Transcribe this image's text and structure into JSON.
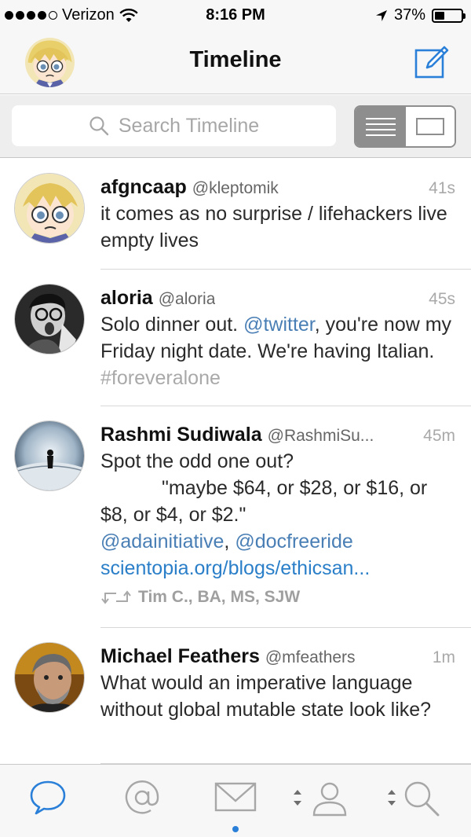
{
  "status_bar": {
    "carrier": "Verizon",
    "time": "8:16 PM",
    "battery_percent": "37%",
    "battery_level": 0.37
  },
  "nav": {
    "title": "Timeline",
    "avatar_icon": "anime-avatar-icon",
    "compose_icon": "compose-icon"
  },
  "search": {
    "placeholder": "Search Timeline",
    "view_mode": "list"
  },
  "colors": {
    "accent": "#2a7fd8",
    "mention": "#4a7fb5",
    "muted": "#a9a9a9"
  },
  "tweets": [
    {
      "name": "afgncaap",
      "handle": "@kleptomik",
      "time": "41s",
      "text": "it comes as no surprise / lifehackers live empty lives"
    },
    {
      "name": "aloria",
      "handle": "@aloria",
      "time": "45s",
      "text_1": "Solo dinner out. ",
      "mention": "@twitter",
      "text_2": ", you're now my Friday night date. We're having Italian. ",
      "hashtag": "#foreveralone"
    },
    {
      "name": "Rashmi Sudiwala",
      "handle": "@RashmiSu...",
      "time": "45m",
      "text_1": "Spot the odd one out?",
      "text_2": "\"maybe $64, or $28, or $16, or $8, or $4, or $2.\"",
      "mention_1": "@adainitiative",
      "separator": ", ",
      "mention_2": "@docfreeride",
      "link": "scientopia.org/blogs/ethicsan...",
      "retweeted_by": "Tim C., BA, MS, SJW"
    },
    {
      "name": "Michael Feathers",
      "handle": "@mfeathers",
      "time": "1m",
      "text": "What would an imperative language without global mutable state look like?"
    }
  ],
  "tab_bar": {
    "tabs": [
      "timeline-tab",
      "mentions-tab",
      "messages-tab",
      "profile-tab",
      "search-tab"
    ],
    "active": "timeline-tab",
    "unread_indicator": "messages-tab"
  }
}
